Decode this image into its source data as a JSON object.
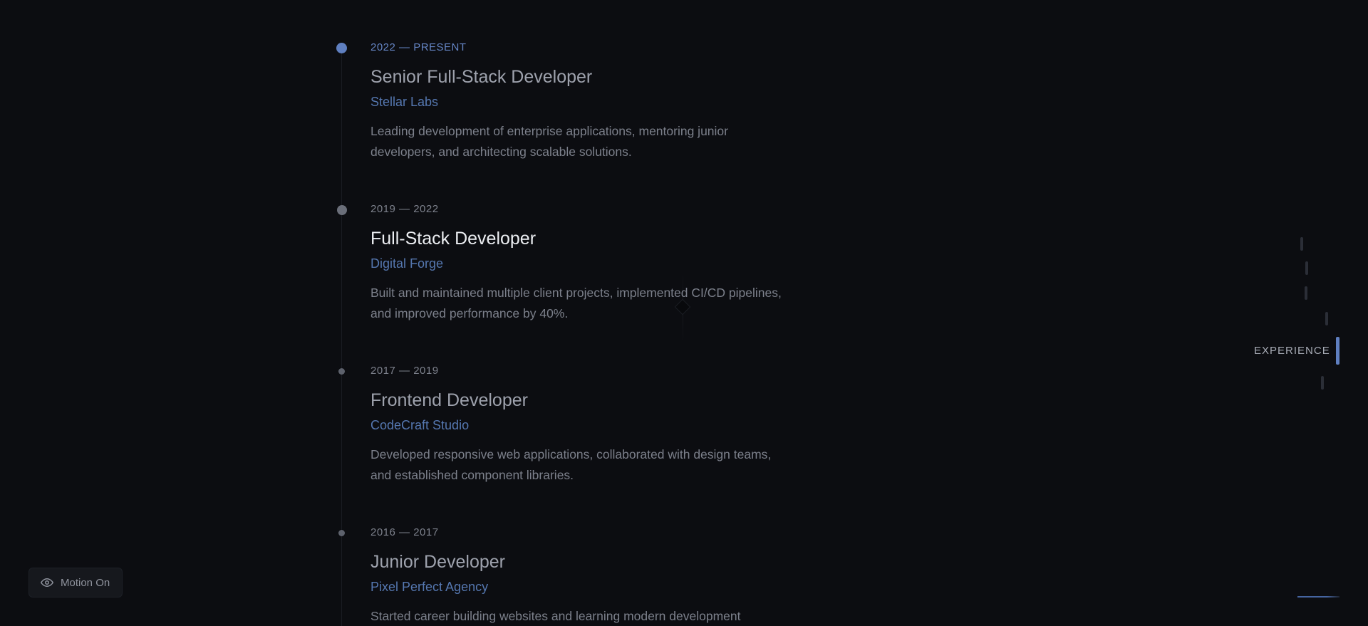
{
  "timeline": {
    "entries": [
      {
        "date": "2022 — PRESENT",
        "title": "Senior Full-Stack Developer",
        "company": "Stellar Labs",
        "description": "Leading development of enterprise applications, mentoring junior developers, and architecting scalable solutions."
      },
      {
        "date": "2019 — 2022",
        "title": "Full-Stack Developer",
        "company": "Digital Forge",
        "description": "Built and maintained multiple client projects, implemented CI/CD pipelines, and improved performance by 40%."
      },
      {
        "date": "2017 — 2019",
        "title": "Frontend Developer",
        "company": "CodeCraft Studio",
        "description": "Developed responsive web applications, collaborated with design teams, and established component libraries."
      },
      {
        "date": "2016 — 2017",
        "title": "Junior Developer",
        "company": "Pixel Perfect Agency",
        "description": "Started career building websites and learning modern development"
      }
    ]
  },
  "section_nav": {
    "active_label": "EXPERIENCE"
  },
  "motion_toggle": {
    "label": "Motion On",
    "icon": "eye-icon"
  },
  "colors": {
    "background": "#0c0d11",
    "accent": "#5f7fc0",
    "company": "#5577b0"
  }
}
